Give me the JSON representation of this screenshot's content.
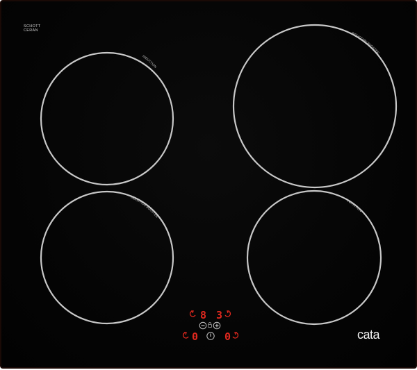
{
  "cooktop": {
    "glass_stamp": [
      "SCHOTT",
      "CERAN"
    ],
    "zones": [
      {
        "id": "rear-left",
        "label": "INDUCTION"
      },
      {
        "id": "rear-right",
        "label": "INDUCTION BOOSTER"
      },
      {
        "id": "front-left",
        "label": "INDUCTION BOOSTER"
      },
      {
        "id": "front-right",
        "label": "INDUCTION"
      }
    ],
    "controls": {
      "rear_left_level": "8",
      "rear_right_level": "3",
      "front_left_level": "0",
      "front_right_level": "0"
    },
    "brand": "cata",
    "colors": {
      "glass": "#050505",
      "zone_ring": "#c8c8c8",
      "display": "#e0281e"
    }
  }
}
